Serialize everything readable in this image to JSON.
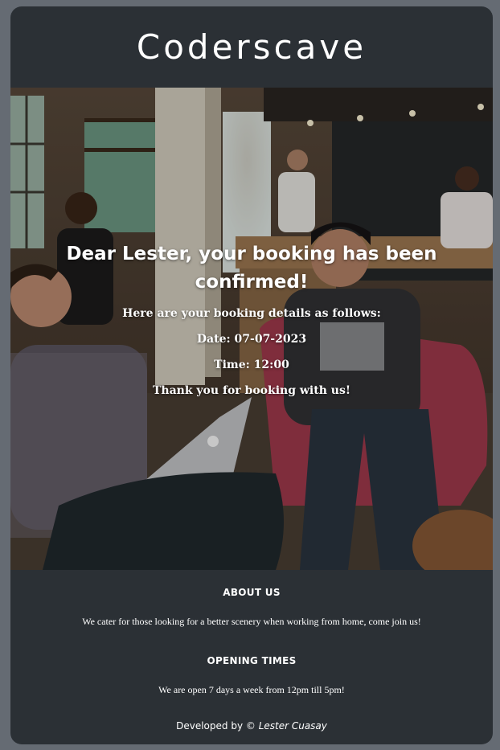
{
  "brand": {
    "title": "Coderscave"
  },
  "booking": {
    "title": "Dear Lester, your booking has been confirmed!",
    "intro": "Here are your booking details as follows:",
    "date": "Date: 07-07-2023",
    "time": "Time: 12:00",
    "thanks": "Thank you for booking with us!"
  },
  "footer": {
    "about_heading": "ABOUT US",
    "about_text": "We cater for those looking for a better scenery when working from home, come join us!",
    "hours_heading": "OPENING TIMES",
    "hours_text": "We are open 7 days a week from 12pm till 5pm!",
    "credit_prefix": "Developed by ©",
    "credit_author": "Lester Cuasay"
  },
  "colors": {
    "page_background": "#656b73",
    "card_background": "#2b3035",
    "text": "#ffffff"
  }
}
